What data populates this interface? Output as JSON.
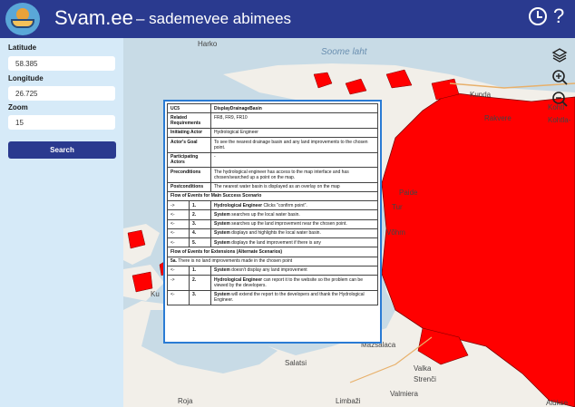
{
  "header": {
    "app_title": "Svam.ee",
    "subtitle": "– sademevee abimees",
    "help_label": "?"
  },
  "sidebar": {
    "latitude_label": "Latitude",
    "latitude_value": "58.385",
    "longitude_label": "Longitude",
    "longitude_value": "26.725",
    "zoom_label": "Zoom",
    "zoom_value": "15",
    "search_label": "Search"
  },
  "map": {
    "labels": {
      "harko": "Harko",
      "soome_laht": "Soome laht",
      "kunda": "Kunda",
      "rakvere": "Rakvere",
      "kohtla": "Kohtl",
      "kohtla2": "Kohtla-",
      "paide": "Paide",
      "tur": "Tur",
      "vohma": "Võhm",
      "ku": "Ku",
      "mazsalaca": "Mazsalaca",
      "salatsi": "Salatsi",
      "valka": "Valka",
      "strenci": "Strenči",
      "valmiera": "Valmiera",
      "roja": "Roja",
      "limbazi": "Limbaži",
      "aluksne": "Alūkse"
    },
    "colors": {
      "water": "#c8dbe6",
      "land": "#f2efe9",
      "basin": "#ff0000",
      "basin_stroke": "#7a0000"
    }
  },
  "use_case": {
    "id_key": "UC5",
    "id_value": "DisplayDrainageBasin",
    "rows": [
      {
        "key": "Related Requirements",
        "value": "FR8, FR9, FR10"
      },
      {
        "key": "Initiating Actor",
        "value": "Hydrological Engineer"
      },
      {
        "key": "Actor's Goal",
        "value": "To see the nearest drainage basin and any land improvements to the chosen point."
      },
      {
        "key": "Participating Actors",
        "value": "-"
      },
      {
        "key": "Preconditions",
        "value": "The hydrological engineer has access to the map interface and has chosen/searched up a point on the map."
      },
      {
        "key": "Postconditions",
        "value": "The nearest water basin is displayed as an overlay on the map"
      }
    ],
    "main_flow_title": "Flow of Events for Main Success Scenario",
    "main_flow": [
      {
        "dir": "->",
        "num": "1.",
        "actor": "Hydrological Engineer",
        "text": " Clicks \"confirm point\"."
      },
      {
        "dir": "<-",
        "num": "2.",
        "actor": "System",
        "text": " searches up the local water basin."
      },
      {
        "dir": "<-",
        "num": "3.",
        "actor": "System",
        "text": " searches up the land improvement near the chosen point."
      },
      {
        "dir": "<-",
        "num": "4.",
        "actor": "System",
        "text": " displays and highlights the local water basin."
      },
      {
        "dir": "<-",
        "num": "5.",
        "actor": "System",
        "text": " displays the land improvement if there is any"
      }
    ],
    "ext_flow_title": "Flow of Events for Extensions (Alternate Scenarios)",
    "ext_intro_num": "5a.",
    "ext_intro_text": " There is no land improvements made in the chosen point",
    "ext_flow": [
      {
        "dir": "<-",
        "num": "1.",
        "actor": "System",
        "text": " doesn't display any land improvement"
      },
      {
        "dir": "->",
        "num": "2.",
        "actor": "Hydrological Engineer",
        "text": " can report it to the website so the problem can be viewed by the developers."
      },
      {
        "dir": "<-",
        "num": "3.",
        "actor": "System",
        "text": " will extend the report to the developers and thank the Hydrological Engineer."
      }
    ]
  }
}
